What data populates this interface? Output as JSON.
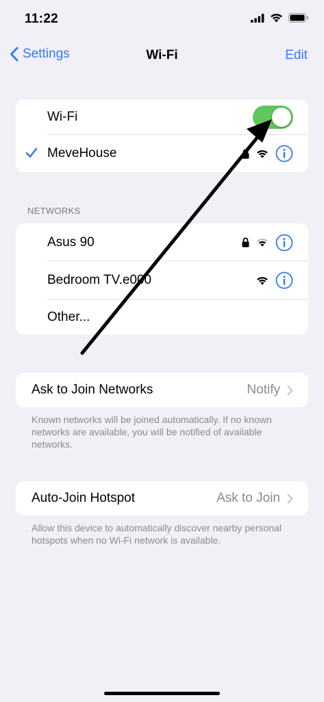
{
  "status_bar": {
    "time": "11:22",
    "icons": [
      "cellular-signal-icon",
      "wifi-icon",
      "battery-icon"
    ]
  },
  "nav": {
    "back_label": "Settings",
    "title": "Wi-Fi",
    "edit_label": "Edit"
  },
  "wifi_card": {
    "toggle_label": "Wi-Fi",
    "toggle_on": true,
    "connected_network": "MeveHouse"
  },
  "networks": {
    "header": "NETWORKS",
    "items": [
      {
        "name": "Asus 90",
        "secured": true
      },
      {
        "name": "Bedroom TV.e000",
        "secured": false
      }
    ],
    "other_label": "Other..."
  },
  "ask_to_join": {
    "label": "Ask to Join Networks",
    "value": "Notify",
    "footer": "Known networks will be joined automatically. If no known networks are available, you will be notified of available networks."
  },
  "auto_join": {
    "label": "Auto-Join Hotspot",
    "value": "Ask to Join",
    "footer": "Allow this device to automatically discover nearby personal hotspots when no Wi-Fi network is available."
  },
  "colors": {
    "accent": "#3478f6",
    "toggle_on": "#5fc65d",
    "background": "#f1f0f6",
    "annotation_arrow": "#000000"
  }
}
